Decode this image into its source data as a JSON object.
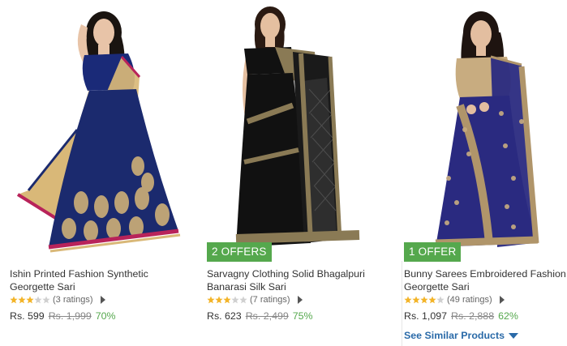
{
  "products": [
    {
      "title": "Ishin Printed Fashion Synthetic Georgette Sari",
      "rating_stars": 3,
      "ratings_text": "(3 ratings)",
      "price": "Rs. 599",
      "mrp": "Rs. 1,999",
      "discount": "70%",
      "offer": "",
      "colors": {
        "blouse": "#1a2a78",
        "pallu": "#d9b878",
        "border": "#b8235a",
        "skirt": "#1b2a6e",
        "pattern": "#d9b878"
      }
    },
    {
      "title": "Sarvagny Clothing Solid Bhagalpuri Banarasi Silk Sari",
      "rating_stars": 3,
      "ratings_text": "(7 ratings)",
      "price": "Rs. 623",
      "mrp": "Rs. 2,499",
      "discount": "75%",
      "offer": "2 OFFERS",
      "colors": {
        "body": "#111111",
        "border": "#8a7a55",
        "pallu": "#2a2a2a"
      }
    },
    {
      "title": "Bunny Sarees Embroidered Fashion Georgette Sari",
      "rating_stars": 4,
      "ratings_text": "(49 ratings)",
      "price": "Rs. 1,097",
      "mrp": "Rs. 2,888",
      "discount": "62%",
      "offer": "1 OFFER",
      "colors": {
        "body": "#2a2a80",
        "border": "#b0956a",
        "blouse": "#c8ac80"
      }
    }
  ],
  "see_similar": "See Similar Products",
  "colors": {
    "offer_badge": "#55a84d",
    "discount": "#55a84d",
    "link": "#2a6aa8",
    "star_on": "#f3b428",
    "star_off": "#d0d0d0"
  }
}
